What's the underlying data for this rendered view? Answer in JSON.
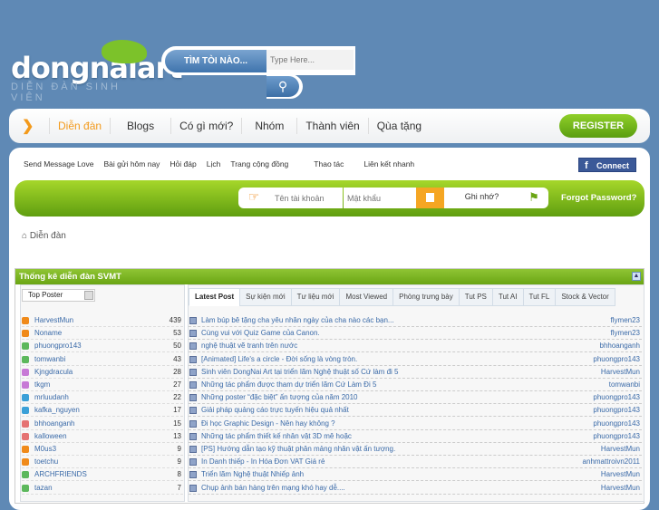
{
  "logo": {
    "text": "dongnaiart",
    "tagline": "DIỄN ĐÀN SINH VIÊN"
  },
  "search": {
    "button": "TÌM TÒI NÀO...",
    "placeholder": "Type Here..."
  },
  "nav": {
    "items": [
      "Diễn đàn",
      "Blogs",
      "Có gì mới?",
      "Nhóm",
      "Thành viên",
      "Qùa tặng"
    ],
    "register": "REGISTER"
  },
  "sublinks": [
    "Send Message Love",
    "Bài gửi hôm nay",
    "Hỏi đáp",
    "Lịch",
    "Trang cộng đồng",
    "Thao tác",
    "Liên kết nhanh"
  ],
  "facebook": {
    "icon": "f",
    "label": "Connect"
  },
  "login": {
    "username_placeholder": "Tên tài khoản",
    "password_placeholder": "Mật khẩu",
    "remember": "Ghi nhớ?",
    "forgot": "Forgot Password?"
  },
  "breadcrumb": "Diễn đàn",
  "stats": {
    "title": "Thống kê diễn đàn SVMT",
    "select": "Top Poster",
    "posters": [
      [
        "HarvestMun",
        "439",
        "#f08a1a"
      ],
      [
        "Noname",
        "53",
        "#f08a1a"
      ],
      [
        "phuongpro143",
        "50",
        "#5cb85c"
      ],
      [
        "tomwanbi",
        "43",
        "#5cb85c"
      ],
      [
        "Kjngdracula",
        "28",
        "#c77ad6"
      ],
      [
        "tkgm",
        "27",
        "#c77ad6"
      ],
      [
        "mrluudanh",
        "22",
        "#3aa0d8"
      ],
      [
        "kafka_nguyen",
        "17",
        "#3aa0d8"
      ],
      [
        "bhhoanganh",
        "15",
        "#e57373"
      ],
      [
        "kalloween",
        "13",
        "#e57373"
      ],
      [
        "M0us3",
        "9",
        "#f08a1a"
      ],
      [
        "toetchu",
        "9",
        "#f08a1a"
      ],
      [
        "ARCHFRIENDS",
        "8",
        "#5cb85c"
      ],
      [
        "tazan",
        "7",
        "#5cb85c"
      ]
    ],
    "tabs": [
      "Latest Post",
      "Sự kiện mới",
      "Tư liệu mới",
      "Most Viewed",
      "Phòng trưng bày",
      "Tut PS",
      "Tut AI",
      "Tut FL",
      "Stock & Vector"
    ],
    "threads": [
      [
        "Làm búp bê tặng cha yêu nhân ngày của cha nào các bạn...",
        "flymen23"
      ],
      [
        "Cùng vui với Quiz Game của Canon.",
        "flymen23"
      ],
      [
        "nghệ thuật vẽ tranh trên nước",
        "bhhoanganh"
      ],
      [
        "[Animated] Life's a circle - Đời sống là vòng tròn.",
        "phuongpro143"
      ],
      [
        "Sinh viên DongNai Art tại triển lãm Nghệ thuật số Cứ làm đi 5",
        "HarvestMun"
      ],
      [
        "Những tác phẩm được tham dự triển lãm Cứ Làm Đi 5",
        "tomwanbi"
      ],
      [
        "Những poster “đặc biệt” ấn tượng của năm 2010",
        "phuongpro143"
      ],
      [
        "Giải pháp quảng cáo trực tuyến hiệu quả nhất",
        "phuongpro143"
      ],
      [
        "Đi học Graphic Design - Nên hay không ?",
        "phuongpro143"
      ],
      [
        "Những tác phẩm thiết kế nhân vật 3D mê hoặc",
        "phuongpro143"
      ],
      [
        "[PS] Hướng dẫn tạo kỹ thuật phân mảng nhân vật ấn tượng.",
        "HarvestMun"
      ],
      [
        "In Danh thiếp - In Hóa Đơn VAT Giá rẻ",
        "anhmattroivn2011"
      ],
      [
        "Triển lãm Nghệ thuật Nhiếp ảnh",
        "HarvestMun"
      ],
      [
        "Chụp ảnh bán hàng trên mạng khó hay dễ....",
        "HarvestMun"
      ]
    ]
  }
}
